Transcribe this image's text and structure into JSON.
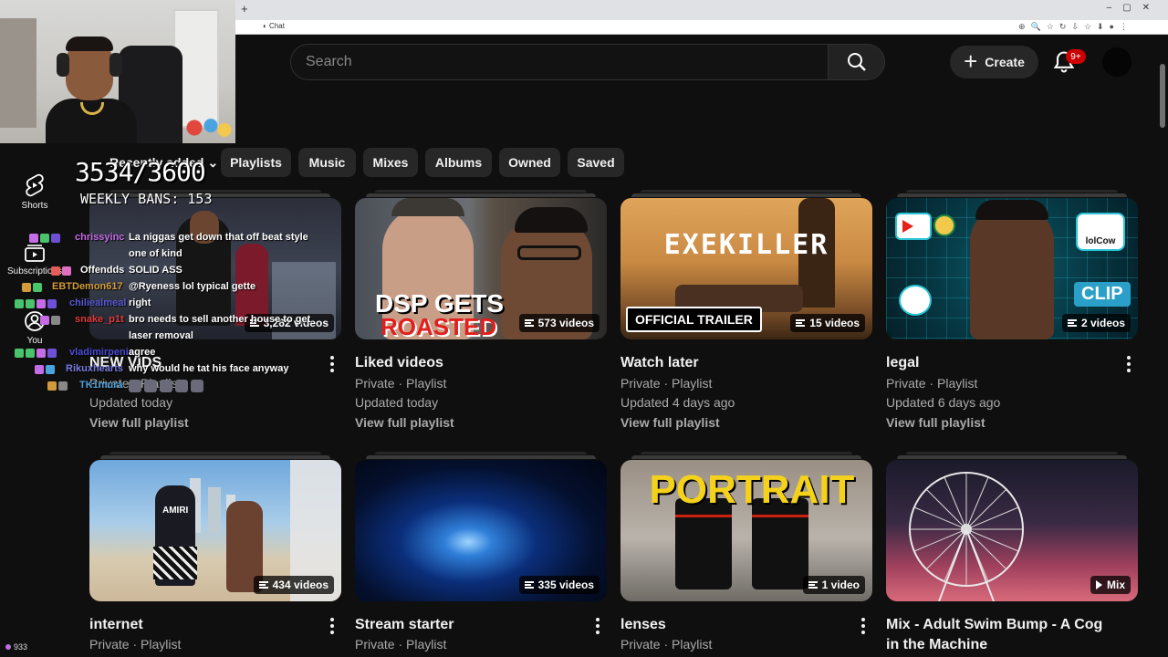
{
  "header": {
    "search_placeholder": "Search",
    "create_label": "Create",
    "notifications_badge": "9+"
  },
  "rail": {
    "shorts": "Shorts",
    "subscriptions": "Subscriptions",
    "you": "You",
    "viewer_count": "933"
  },
  "filters": {
    "sort_label": "Recently added",
    "chips": [
      "Playlists",
      "Music",
      "Mixes",
      "Albums",
      "Owned",
      "Saved"
    ]
  },
  "overlay": {
    "counter": "3534/3600",
    "weekly_bans": "WEEKLY BANS: 153",
    "chat": [
      {
        "user": "chrissyinc",
        "color": "#c56ce6",
        "msg": "La niggas get down that off beat style",
        "cont": "one of kind"
      },
      {
        "user": "Offendds",
        "color": "#ffffff",
        "msg": "SOLID ASS"
      },
      {
        "user": "EBTDemon617",
        "color": "#d39a3b",
        "msg": "@Ryeness lol typical gette"
      },
      {
        "user": "chiliealmeal",
        "color": "#5a5ad6",
        "msg": "right"
      },
      {
        "user": "snake_p1t",
        "color": "#e23a3a",
        "msg": "bro needs to sell another house to get",
        "cont": "laser removal"
      },
      {
        "user": "vladimirpenis",
        "color": "#4b4bd8",
        "msg": "agree"
      },
      {
        "user": "Rikuxhearts",
        "color": "#7a7ae0",
        "msg": "why would he tat his face anyway"
      },
      {
        "user": "TK1mura",
        "color": "#4aa3df",
        "msg": ""
      }
    ]
  },
  "playlists": [
    {
      "title": "NEW VIDS",
      "count": "3,262 videos",
      "meta": "Private · Playlist",
      "updated": "Updated today",
      "view": "View full playlist"
    },
    {
      "title": "Liked videos",
      "count": "573 videos",
      "meta": "Private · Playlist",
      "updated": "Updated today",
      "view": "View full playlist",
      "thumb_text": [
        "DSP GETS",
        "ROASTED"
      ]
    },
    {
      "title": "Watch later",
      "count": "15 videos",
      "meta": "Private · Playlist",
      "updated": "Updated 4 days ago",
      "view": "View full playlist",
      "thumb_text": [
        "EXEKILLER",
        "OFFICIAL TRAILER"
      ]
    },
    {
      "title": "legal",
      "count": "2 videos",
      "meta": "Private · Playlist",
      "updated": "Updated 6 days ago",
      "view": "View full playlist",
      "thumb_text": [
        "CLIP",
        "lolCow"
      ]
    },
    {
      "title": "internet",
      "count": "434 videos",
      "meta": "Private · Playlist",
      "thumb_text": [
        "AMIRI"
      ]
    },
    {
      "title": "Stream starter",
      "count": "335 videos",
      "meta": "Private · Playlist"
    },
    {
      "title": "lenses",
      "count": "1 video",
      "meta": "Private · Playlist",
      "thumb_text": [
        "PORTRAIT"
      ]
    },
    {
      "title": "Mix - Adult Swim Bump - A Cog in the Machine",
      "count": "Mix"
    }
  ]
}
